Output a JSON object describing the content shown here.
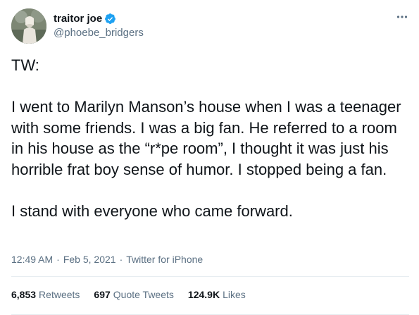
{
  "user": {
    "display_name": "traitor joe",
    "handle": "@phoebe_bridgers",
    "verified_icon": "verified-badge-icon"
  },
  "menu": {
    "more_icon": "more-horizontal-icon"
  },
  "tweet": {
    "line_tw": "TW:",
    "paragraph_1": "I went to Marilyn Manson’s house when I was a teenager with some friends. I was a big fan. He referred to a room in his house as the “r*pe room”, I thought it was just his horrible frat boy sense of humor. I stopped being a fan.",
    "paragraph_2": "I stand with everyone who came forward."
  },
  "meta": {
    "time": "12:49 AM",
    "date": "Feb 5, 2021",
    "source": "Twitter for iPhone",
    "separator": "·"
  },
  "stats": {
    "retweets_count": "6,853",
    "retweets_label": "Retweets",
    "quotes_count": "697",
    "quotes_label": "Quote Tweets",
    "likes_count": "124.9K",
    "likes_label": "Likes"
  },
  "colors": {
    "text": "#0f1419",
    "secondary": "#5b7083",
    "verified": "#1da1f2",
    "divider": "#e6ecf0"
  }
}
